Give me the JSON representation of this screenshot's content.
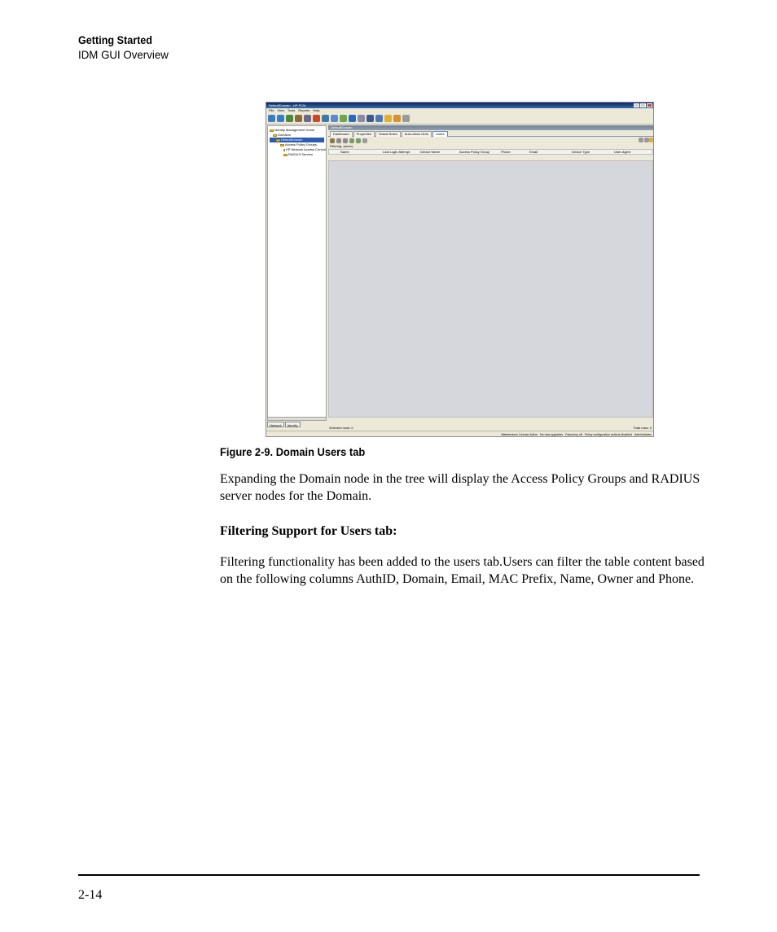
{
  "header": {
    "chapter": "Getting Started",
    "section": "IDM GUI Overview"
  },
  "screenshot": {
    "window_title": "DefaultDomain - HP PCM",
    "menu": [
      "File",
      "View",
      "Tools",
      "Reports",
      "Help"
    ],
    "tree": [
      {
        "label": "Identity Management Home",
        "indent": 0
      },
      {
        "label": "Domains",
        "indent": 1
      },
      {
        "label": "DefaultDomain",
        "indent": 2,
        "selected": true
      },
      {
        "label": "Access Policy Groups",
        "indent": 3
      },
      {
        "label": "HP Network Access Control",
        "indent": 3
      },
      {
        "label": "RADIUS Servers",
        "indent": 3
      }
    ],
    "left_tabs": [
      "Network",
      "Identity"
    ],
    "panel_title": "DefaultDomain",
    "tabs": [
      "Dashboard",
      "Properties",
      "Global Rules",
      "Auto-Allow OUIs",
      "Users"
    ],
    "active_tab": "Users",
    "filtering": "Filtering: (none)",
    "columns": [
      "Name",
      "Last Login Attempt",
      "Device Name",
      "Access Policy Group",
      "Phone",
      "Email",
      "Device Type",
      "User-Agent"
    ],
    "selected_rows": "Selected rows: 0",
    "total_rows": "Total rows: 0",
    "status": [
      "Maintenance License Active",
      "No new upgrades",
      "Discovery off",
      "Policy configuration actions disabled",
      "Administrator"
    ]
  },
  "caption": "Figure 2-9. Domain Users tab",
  "paragraph1": "Expanding the Domain node in the tree will display the Access Policy Groups and RADIUS server nodes for the Domain.",
  "subheading": "Filtering Support for Users tab:",
  "paragraph2": "Filtering functionality has been added to the users tab.Users can filter the table content based on the following columns AuthID, Domain, Email, MAC Prefix, Name, Owner and Phone.",
  "page_number": "2-14"
}
